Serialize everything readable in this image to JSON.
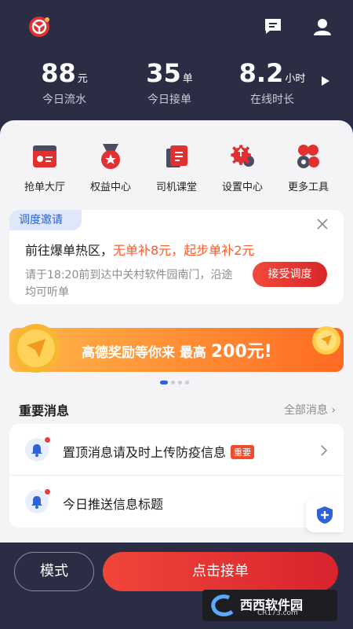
{
  "header": {
    "logo_icon": "app-logo-icon",
    "message_icon": "message-icon",
    "profile_icon": "user-icon"
  },
  "stats": [
    {
      "value": "88",
      "unit": "元",
      "label": "今日流水"
    },
    {
      "value": "35",
      "unit": "单",
      "label": "今日接单"
    },
    {
      "value": "8.2",
      "unit": "小时",
      "label": "在线时长"
    }
  ],
  "tools": [
    {
      "label": "抢单大厅",
      "icon": "order-hall-icon"
    },
    {
      "label": "权益中心",
      "icon": "medal-icon"
    },
    {
      "label": "司机课堂",
      "icon": "book-icon"
    },
    {
      "label": "设置中心",
      "icon": "gear-icon"
    },
    {
      "label": "更多工具",
      "icon": "more-tools-icon"
    }
  ],
  "dispatch": {
    "tag": "调度邀请",
    "title_prefix": "前往爆单热区，",
    "title_highlight": "无单补8元，起步单补2元",
    "desc": "请于18:20前到达中关村软件园南门，沿途均可听单",
    "button": "接受调度"
  },
  "banner": {
    "text": "高德奖励等你来 最高 ",
    "amount": "200元!"
  },
  "messages": {
    "title": "重要消息",
    "all_link": "全部消息 ›",
    "items": [
      {
        "text": "置顶消息请及时上传防疫信息",
        "badge": "重要"
      },
      {
        "text": "今日推送信息标题",
        "badge": ""
      }
    ]
  },
  "bottom": {
    "mode_label": "模式",
    "accept_label": "点击接单"
  },
  "watermark": {
    "name": "西西软件园",
    "url": "CR173.com"
  },
  "colors": {
    "dark_bg": "#2b2d44",
    "accent_red": "#e0302f",
    "accent_orange": "#ff5a2a",
    "accent_blue": "#2d62d8"
  }
}
